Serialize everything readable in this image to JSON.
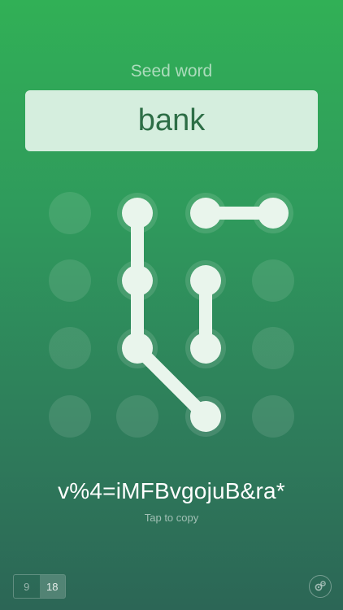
{
  "seed": {
    "label": "Seed word",
    "value": "bank"
  },
  "pattern": {
    "grid_size": 4,
    "path": [
      [
        1,
        0
      ],
      [
        1,
        1
      ],
      [
        1,
        2
      ],
      [
        2,
        3
      ]
    ],
    "segments": [
      [
        [
          2,
          0
        ],
        [
          3,
          0
        ]
      ],
      [
        [
          2,
          1
        ],
        [
          2,
          2
        ]
      ]
    ]
  },
  "result": {
    "password": "v%4=iMFBvgojuB&ra*",
    "hint": "Tap to copy"
  },
  "length_toggle": {
    "options": [
      "9",
      "18"
    ],
    "selected": "18"
  },
  "settings": {
    "icon": "gears-icon"
  }
}
